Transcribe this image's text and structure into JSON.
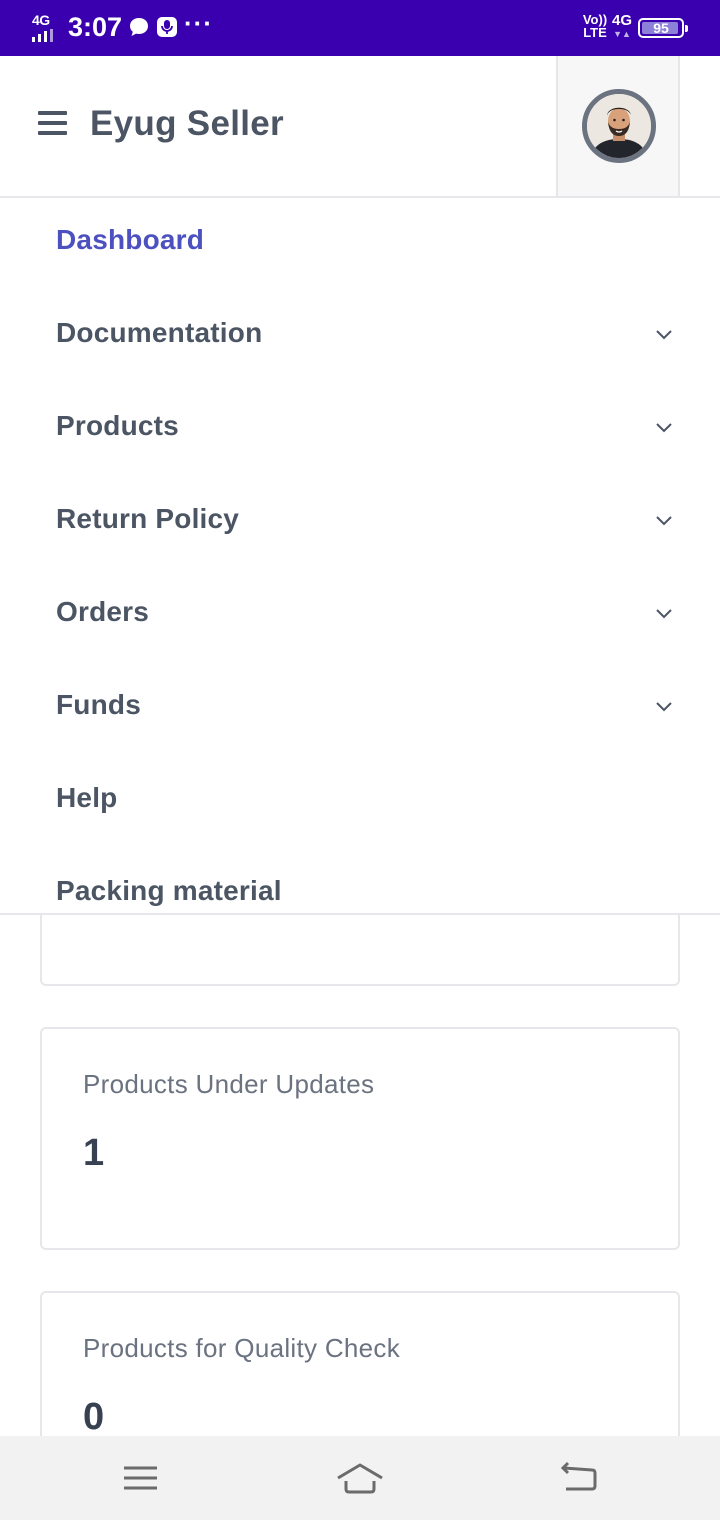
{
  "status_bar": {
    "network_label": "4G",
    "time": "3:07",
    "icons": [
      "signal-icon",
      "message-icon",
      "microphone-icon",
      "more-dots-icon",
      "volte-icon",
      "4g-icon",
      "battery-icon"
    ],
    "more": "···",
    "volte_top": "Vo))",
    "volte_bottom": "LTE",
    "data_network": "4G",
    "battery_level": 95,
    "battery_text": "95"
  },
  "header": {
    "title": "Eyug Seller"
  },
  "menu": {
    "items": [
      {
        "label": "Dashboard",
        "active": true,
        "expandable": false
      },
      {
        "label": "Documentation",
        "active": false,
        "expandable": true
      },
      {
        "label": "Products",
        "active": false,
        "expandable": true
      },
      {
        "label": "Return Policy",
        "active": false,
        "expandable": true
      },
      {
        "label": "Orders",
        "active": false,
        "expandable": true
      },
      {
        "label": "Funds",
        "active": false,
        "expandable": true
      },
      {
        "label": "Help",
        "active": false,
        "expandable": false
      },
      {
        "label": "Packing material",
        "active": false,
        "expandable": false
      }
    ]
  },
  "cards": [
    {
      "label": "Products Under Updates",
      "value": "1"
    },
    {
      "label": "Products for Quality Check",
      "value": "0"
    }
  ],
  "colors": {
    "status_bar": "#3a00b0",
    "active_menu": "#4c51bf",
    "menu_text": "#4b5563"
  }
}
